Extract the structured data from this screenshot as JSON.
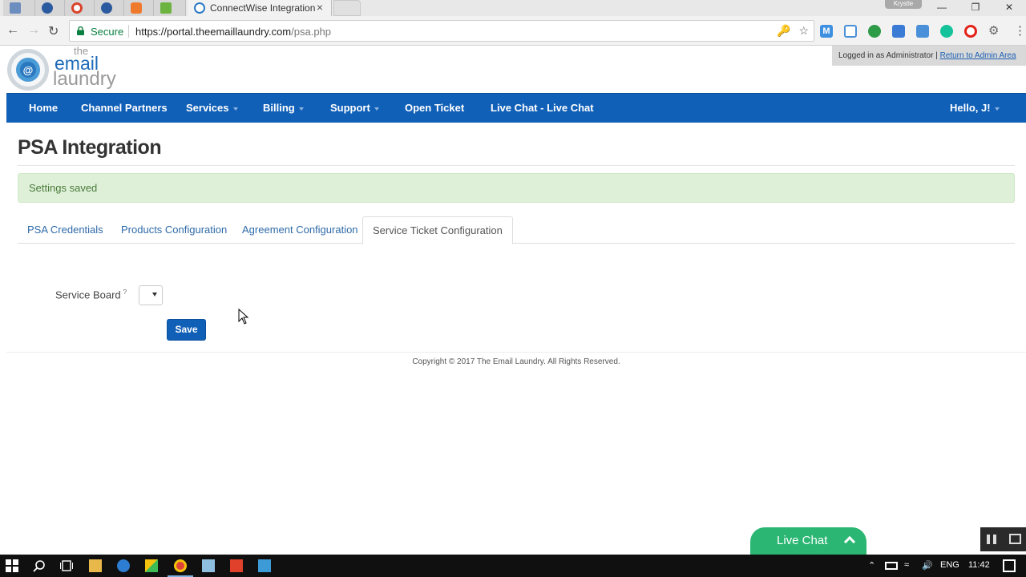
{
  "browser": {
    "tabs": [
      {
        "title": "",
        "favicon_color": "#6c8ebf"
      },
      {
        "title": "",
        "favicon_color": "#2c5aa0"
      },
      {
        "title": "",
        "favicon_color": "#d9442b"
      },
      {
        "title": "",
        "favicon_color": "#2c5aa0"
      },
      {
        "title": "",
        "favicon_color": "#ef7a2e"
      },
      {
        "title": "",
        "favicon_color": "#6cb33f"
      }
    ],
    "active_tab": {
      "title": "ConnectWise Integration",
      "close": "×"
    },
    "profile_name": "Krystle",
    "secure_label": "Secure",
    "url_host": "https://portal.theemaillaundry.com",
    "url_path": "/psa.php"
  },
  "brand": {
    "line1": "the",
    "line2": "email",
    "line3": "laundry"
  },
  "admin_bar": {
    "text": "Logged in as Administrator | ",
    "link": "Return to Admin Area"
  },
  "nav": {
    "items": [
      {
        "label": "Home",
        "dropdown": false
      },
      {
        "label": "Channel Partners",
        "dropdown": false
      },
      {
        "label": "Services",
        "dropdown": true
      },
      {
        "label": "Billing",
        "dropdown": true
      },
      {
        "label": "Support",
        "dropdown": true
      },
      {
        "label": "Open Ticket",
        "dropdown": false
      },
      {
        "label": "Live Chat - Live Chat",
        "dropdown": false
      }
    ],
    "user_label": "Hello, J!"
  },
  "page": {
    "title": "PSA Integration",
    "alert": "Settings saved",
    "tabs": [
      {
        "label": "PSA Credentials",
        "active": false
      },
      {
        "label": "Products Configuration",
        "active": false
      },
      {
        "label": "Agreement Configuration",
        "active": false
      },
      {
        "label": "Service Ticket Configuration",
        "active": true
      }
    ],
    "form": {
      "service_board_label": "Service Board",
      "service_board_help": "?",
      "service_board_value": "",
      "save_label": "Save"
    },
    "copyright": "Copyright © 2017 The Email Laundry. All Rights Reserved."
  },
  "live_chat": {
    "label": "Live Chat"
  },
  "taskbar": {
    "language": "ENG",
    "time": "11:42"
  },
  "colors": {
    "nav_blue": "#1160b8",
    "alert_green": "#dff0d8",
    "live_chat_green": "#2bb673"
  }
}
